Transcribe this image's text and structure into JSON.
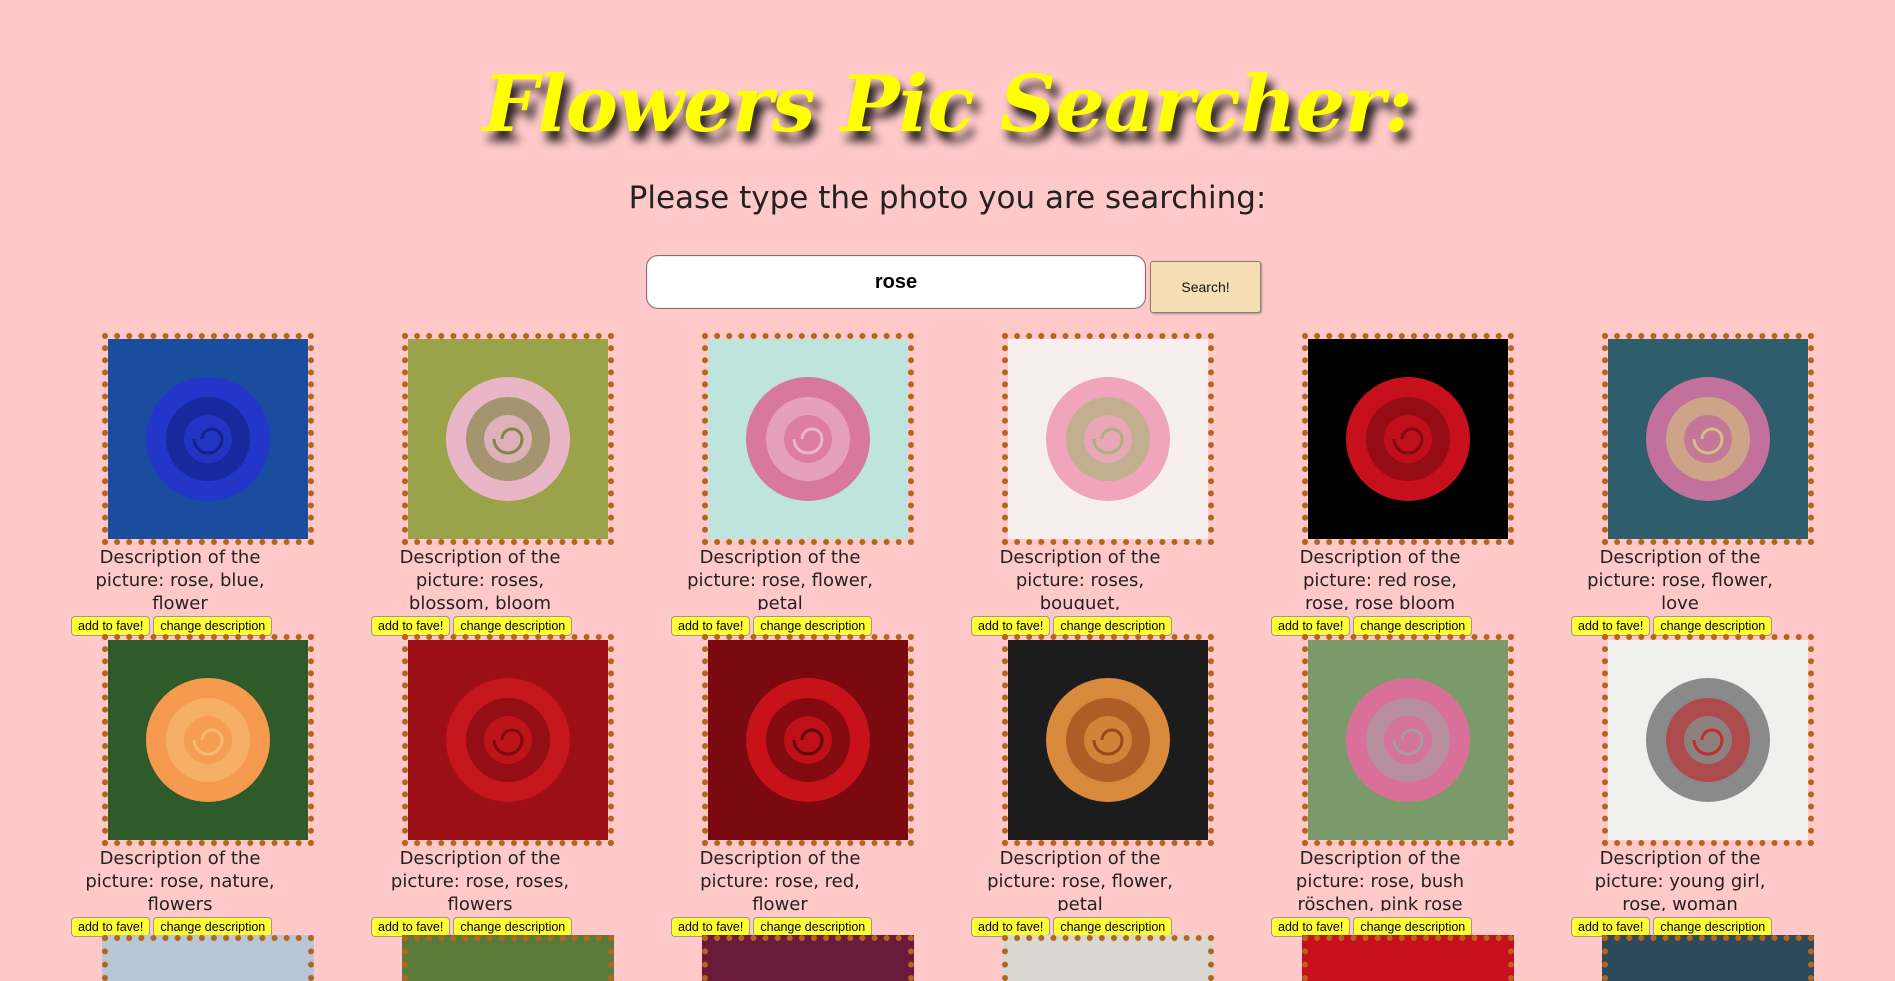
{
  "header": {
    "title": "Flowers Pic Searcher:",
    "subtitle": "Please type the photo you are searching:"
  },
  "search": {
    "value": "rose",
    "button_label": "Search!"
  },
  "card_buttons": {
    "fave": "add to fave!",
    "change": "change description"
  },
  "results": [
    {
      "description": "Description of the picture: rose, blue, flower",
      "palette": [
        "#1a4d9e",
        "#2436c9",
        "#0f1f7a"
      ]
    },
    {
      "description": "Description of the picture: roses, blossom, bloom",
      "palette": [
        "#9aa24a",
        "#e8b6c6",
        "#6c7a2a"
      ]
    },
    {
      "description": "Description of the picture: rose, flower, petal",
      "palette": [
        "#bfe3dd",
        "#d9789e",
        "#f0c3d2"
      ]
    },
    {
      "description": "Description of the picture: roses, bouquet, congratulations",
      "palette": [
        "#f7eeee",
        "#f0a5bd",
        "#9ab86a"
      ]
    },
    {
      "description": "Description of the picture: red rose, rose, rose bloom",
      "palette": [
        "#000000",
        "#c8101c",
        "#6b0a0f"
      ]
    },
    {
      "description": "Description of the picture: rose, flower, love",
      "palette": [
        "#2e5d6b",
        "#c2709c",
        "#d8d07a"
      ]
    },
    {
      "description": "Description of the picture: rose, nature, flowers",
      "palette": [
        "#2f5a2a",
        "#f59a4e",
        "#f6c27a"
      ]
    },
    {
      "description": "Description of the picture: rose, roses, flowers",
      "palette": [
        "#9c0f14",
        "#c4161c",
        "#6b080c"
      ]
    },
    {
      "description": "Description of the picture: rose, red, flower",
      "palette": [
        "#7a0a10",
        "#c8121a",
        "#4a0508"
      ]
    },
    {
      "description": "Description of the picture: rose, flower, petal",
      "palette": [
        "#1c1c1c",
        "#d98a3c",
        "#8a3a14"
      ]
    },
    {
      "description": "Description of the picture: rose, bush röschen, pink rose",
      "palette": [
        "#7a9a6a",
        "#d9709a",
        "#9aa8a0"
      ]
    },
    {
      "description": "Description of the picture: young girl, rose, woman",
      "palette": [
        "#f0f0ee",
        "#8a8a8a",
        "#c81a1a"
      ]
    }
  ]
}
